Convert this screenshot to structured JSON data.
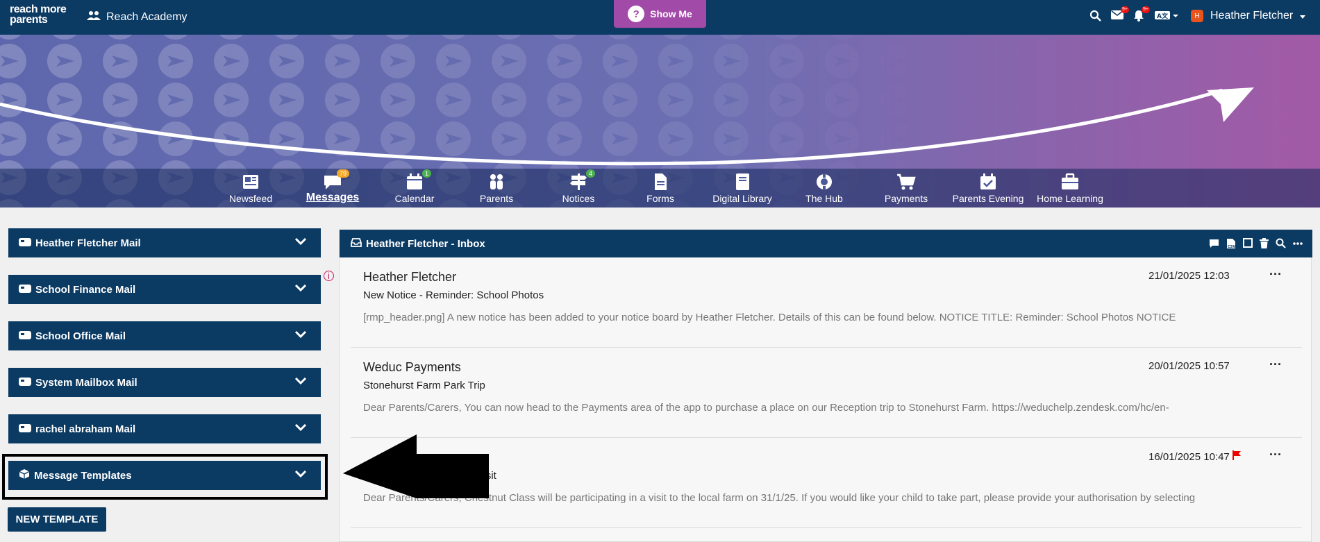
{
  "topbar": {
    "logo_line1": "reach more",
    "logo_line2": "parents",
    "school_name": "Reach Academy",
    "show_me_label": "Show Me",
    "mail_badge": "9+",
    "bell_badge": "9+",
    "user_initial": "H",
    "user_name": "Heather Fletcher"
  },
  "nav": [
    {
      "label": "Newsfeed"
    },
    {
      "label": "Messages",
      "badge": "79"
    },
    {
      "label": "Calendar",
      "badge": "1"
    },
    {
      "label": "Parents"
    },
    {
      "label": "Notices",
      "badge": "4"
    },
    {
      "label": "Forms"
    },
    {
      "label": "Digital Library"
    },
    {
      "label": "The Hub"
    },
    {
      "label": "Payments"
    },
    {
      "label": "Parents Evening"
    },
    {
      "label": "Home Learning"
    }
  ],
  "mailboxes": [
    {
      "label": "Heather Fletcher Mail"
    },
    {
      "label": "School Finance Mail"
    },
    {
      "label": "School Office Mail"
    },
    {
      "label": "System Mailbox Mail"
    },
    {
      "label": "rachel abraham Mail"
    },
    {
      "label": "Message Templates"
    }
  ],
  "new_template_label": "NEW TEMPLATE",
  "inbox": {
    "title": "Heather Fletcher - Inbox",
    "messages": [
      {
        "sender": "Heather Fletcher",
        "subject": "New Notice - Reminder: School Photos",
        "preview": "[rmp_header.png] A new notice has been added to your notice board by Heather Fletcher. Details of this can be found below. NOTICE TITLE: Reminder: School Photos NOTICE",
        "date": "21/01/2025 12:03"
      },
      {
        "sender": "Weduc Payments",
        "subject": "Stonehurst Farm Park Trip",
        "preview": "Dear Parents/Carers, You can now head to the Payments area of the app to purchase a place on our Reception trip to Stonehurst Farm. https://weduchelp.zendesk.com/hc/en-",
        "date": "20/01/2025 10:57"
      },
      {
        "sender": "",
        "subject": "visit",
        "preview": "Dear Parents/Carers, Chestnut Class will be participating in a visit to the local farm on 31/1/25. If you would like your child to take part, please provide your authorisation by selecting",
        "date": "16/01/2025 10:47",
        "flagged": true
      }
    ]
  },
  "colors": {
    "primary": "#0b3a63",
    "show_me": "#a24aa8",
    "badge_orange": "#f5a623",
    "badge_green": "#4caf50",
    "flag": "#e00000"
  }
}
